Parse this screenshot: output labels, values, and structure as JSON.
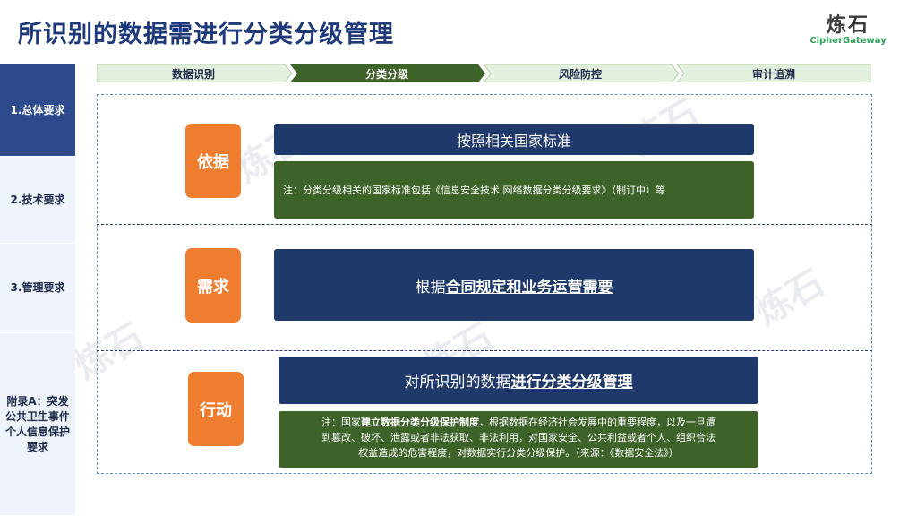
{
  "header": {
    "title": "所识别的数据需进行分类分级管理"
  },
  "logo": {
    "cn": "炼石",
    "en": "CipherGateway"
  },
  "sidebar": {
    "items": [
      {
        "label": "1.总体要求"
      },
      {
        "label": "2.技术要求"
      },
      {
        "label": "3.管理要求"
      },
      {
        "label": "附录A：突发公共卫生事件个人信息保护要求"
      }
    ]
  },
  "steps": [
    {
      "label": "数据识别"
    },
    {
      "label": "分类分级"
    },
    {
      "label": "风险防控"
    },
    {
      "label": "审计追溯"
    }
  ],
  "sections": {
    "basis": {
      "tag": "依据",
      "heading": "按照相关国家标准",
      "note": "注：分类分级相关的国家标准包括《信息安全技术 网络数据分类分级要求》（制订中）等"
    },
    "demand": {
      "tag": "需求",
      "heading_prefix": "根据",
      "heading_emph": "合同规定和业务运营需要"
    },
    "action": {
      "tag": "行动",
      "heading_prefix": "对所识别的数据",
      "heading_emph": "进行分类分级管理",
      "note_prefix": "注：国家",
      "note_emph": "建立数据分类分级保护制度",
      "note_line1_rest": "，根据数据在经济社会发展中的重要程度，以及一旦遭",
      "note_line2": "到篡改、破坏、泄露或者非法获取、非法利用，对国家安全、公共利益或者个人、组织合法",
      "note_line3": "权益造成的危害程度，对数据实行分类分级保护。（来源：《数据安全法》）"
    }
  },
  "colors": {
    "navy": "#1f3a6a",
    "green": "#3d6328",
    "orange": "#ef7d2f",
    "sidebar_active": "#2c4a8c",
    "step_active": "#3d6328",
    "step_idle": "#e4f0de"
  }
}
